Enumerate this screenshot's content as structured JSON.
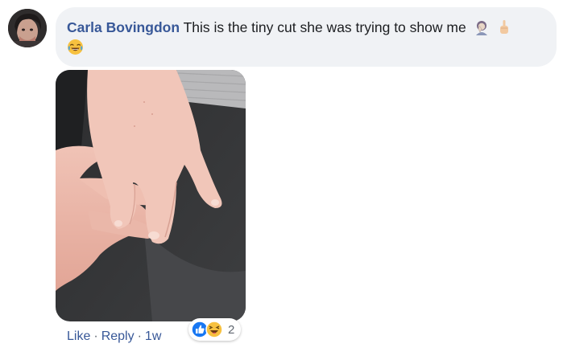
{
  "comment": {
    "author": "Carla Bovingdon",
    "text": "This is the tiny cut she was trying to show me",
    "inline_emojis": [
      "woman-facepalming-icon",
      "pointing-up-icon",
      "joy-emoji-icon"
    ]
  },
  "actions": {
    "like": "Like",
    "reply": "Reply",
    "separator": "·",
    "time": "1w"
  },
  "reactions": {
    "icons": [
      "like-reaction-icon",
      "haha-reaction-icon"
    ],
    "count": "2"
  },
  "colors": {
    "author_link": "#385898",
    "bubble_bg": "#f0f2f5",
    "meta_text": "#606770",
    "like_blue": "#1877f2",
    "haha_yellow": "#f7c13f"
  }
}
